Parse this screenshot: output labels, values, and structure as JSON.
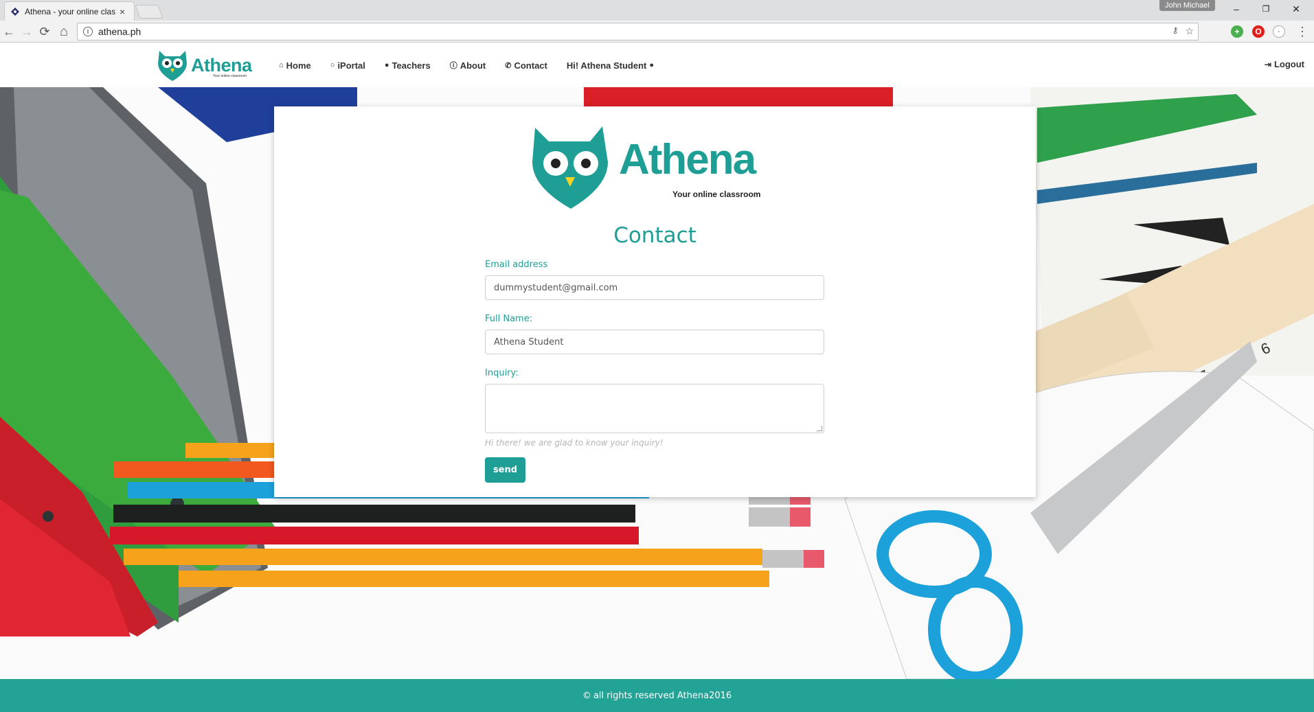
{
  "browser": {
    "tab_title": "Athena - your online class",
    "tab_close": "×",
    "user_name": "John Michael",
    "window_minimize": "–",
    "window_restore": "❐",
    "window_close": "✕",
    "back": "←",
    "forward": "→",
    "reload": "⟳",
    "home": "⌂",
    "info": "i",
    "url": "athena.ph",
    "bookmark": "☆",
    "menu": "⋮"
  },
  "navbar": {
    "brand": "Athena",
    "brand_tagline": "Your online classroom",
    "items": [
      {
        "icon": "home-icon",
        "glyph": "⌂",
        "label": "Home"
      },
      {
        "icon": "comment-icon",
        "glyph": "○",
        "label": "iPortal"
      },
      {
        "icon": "user-icon",
        "glyph": "●",
        "label": "Teachers"
      },
      {
        "icon": "info-circle-icon",
        "glyph": "ⓘ",
        "label": "About"
      },
      {
        "icon": "phone-icon",
        "glyph": "✆",
        "label": "Contact"
      },
      {
        "icon": "user-icon",
        "glyph": "●",
        "label": "Hi! Athena Student"
      }
    ],
    "logout": "Logout",
    "logout_glyph": "⇥"
  },
  "card": {
    "logo_word": "Athena",
    "logo_tagline": "Your online classroom",
    "heading": "Contact",
    "email_label": "Email address",
    "email_value": "dummystudent@gmail.com",
    "name_label": "Full Name:",
    "name_value": "Athena Student",
    "inquiry_label": "Inquiry:",
    "inquiry_value": "",
    "helper": "Hi there! we are glad to know your inquiry!",
    "send_label": "send"
  },
  "footer": {
    "copyright_glyph": "©",
    "text": "all rights reserved Athena2016"
  },
  "colors": {
    "brand_teal": "#1f9e95",
    "footer_teal": "#23a395"
  }
}
